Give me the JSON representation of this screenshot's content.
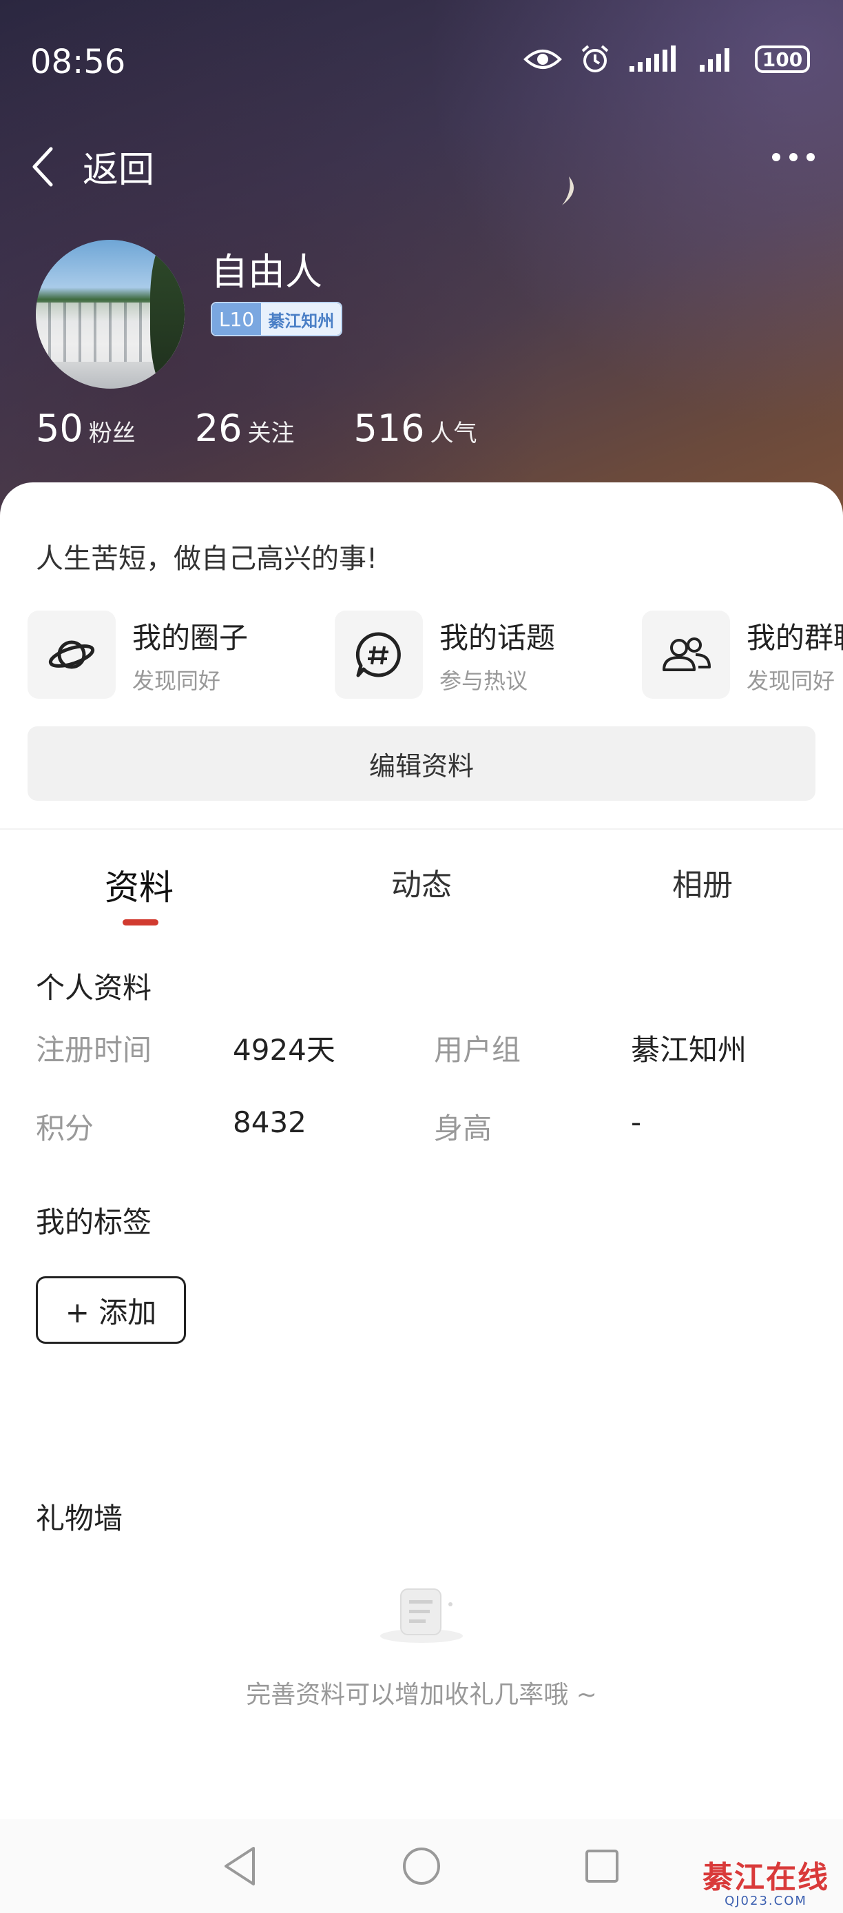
{
  "status_bar": {
    "time": "08:56",
    "battery": "100"
  },
  "nav": {
    "back_label": "返回"
  },
  "profile": {
    "username": "自由人",
    "level": "L10",
    "title": "綦江知州",
    "stats": [
      {
        "value": "50",
        "label": "粉丝"
      },
      {
        "value": "26",
        "label": "关注"
      },
      {
        "value": "516",
        "label": "人气"
      }
    ]
  },
  "bio": "人生苦短，做自己高兴的事!",
  "shortcuts": [
    {
      "title": "我的圈子",
      "sub": "发现同好",
      "icon": "planet-icon"
    },
    {
      "title": "我的话题",
      "sub": "参与热议",
      "icon": "hashtag-chat-icon"
    },
    {
      "title": "我的群聊",
      "sub": "发现同好",
      "icon": "group-icon"
    }
  ],
  "edit_button": "编辑资料",
  "tabs": [
    "资料",
    "动态",
    "相册"
  ],
  "personal": {
    "section_title": "个人资料",
    "rows": [
      {
        "label1": "注册时间",
        "value1": "4924天",
        "label2": "用户组",
        "value2": "綦江知州"
      },
      {
        "label1": "积分",
        "value1": "8432",
        "label2": "身高",
        "value2": "-"
      }
    ]
  },
  "tags": {
    "section_title": "我的标签",
    "add_label": "+ 添加"
  },
  "gifts": {
    "section_title": "礼物墙",
    "empty_text": "完善资料可以增加收礼几率哦 ~"
  },
  "watermark": {
    "main": "綦江在线",
    "sub": "QJ023.COM"
  }
}
